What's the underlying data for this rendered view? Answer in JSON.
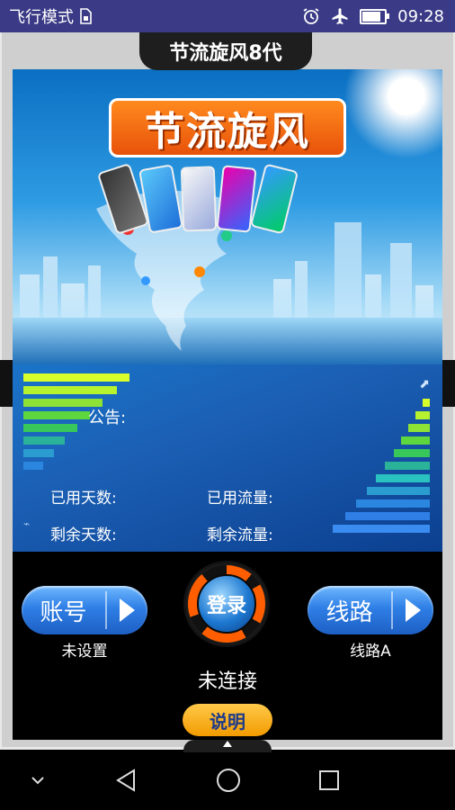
{
  "status_bar": {
    "airplane_mode_label": "飞行模式",
    "time": "09:28",
    "battery_level": 0.75,
    "icons": [
      "sim-card-icon",
      "alarm-icon",
      "airplane-icon",
      "battery-icon"
    ]
  },
  "app": {
    "title": "节流旋风8代",
    "banner_logo": "节流旋风"
  },
  "panel": {
    "announcement_label": "公告:",
    "days_used_label": "已用天数:",
    "traffic_used_label": "已用流量:",
    "days_left_label": "剩余天数:",
    "traffic_left_label": "剩余流量:"
  },
  "controls": {
    "account_button": "账号",
    "account_status": "未设置",
    "login_button": "登录",
    "route_button": "线路",
    "route_status": "线路A",
    "connection_status": "未连接",
    "help_button": "说明"
  },
  "colors": {
    "status_bar": "#3a3a86",
    "accent_orange": "#ff6a10",
    "button_blue": "#2f7fe6",
    "help_yellow": "#f7b21c"
  }
}
